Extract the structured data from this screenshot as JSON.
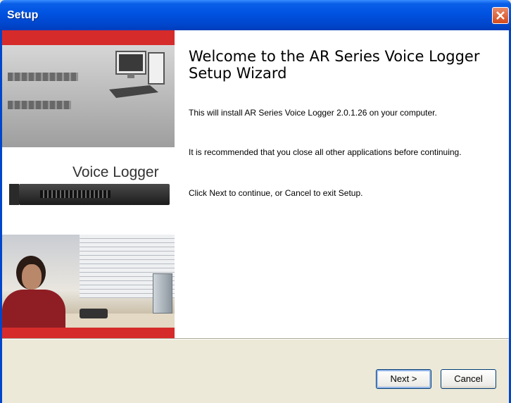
{
  "window": {
    "title": "Setup"
  },
  "side_panel": {
    "product_label": "Voice Logger"
  },
  "content": {
    "heading": "Welcome to the AR Series Voice Logger Setup Wizard",
    "paragraphs": [
      "This will install AR Series Voice Logger 2.0.1.26 on your computer.",
      "It is recommended that you close all other applications before continuing.",
      "Click Next to continue, or Cancel to exit Setup."
    ]
  },
  "buttons": {
    "next_label": "Next >",
    "cancel_label": "Cancel"
  }
}
